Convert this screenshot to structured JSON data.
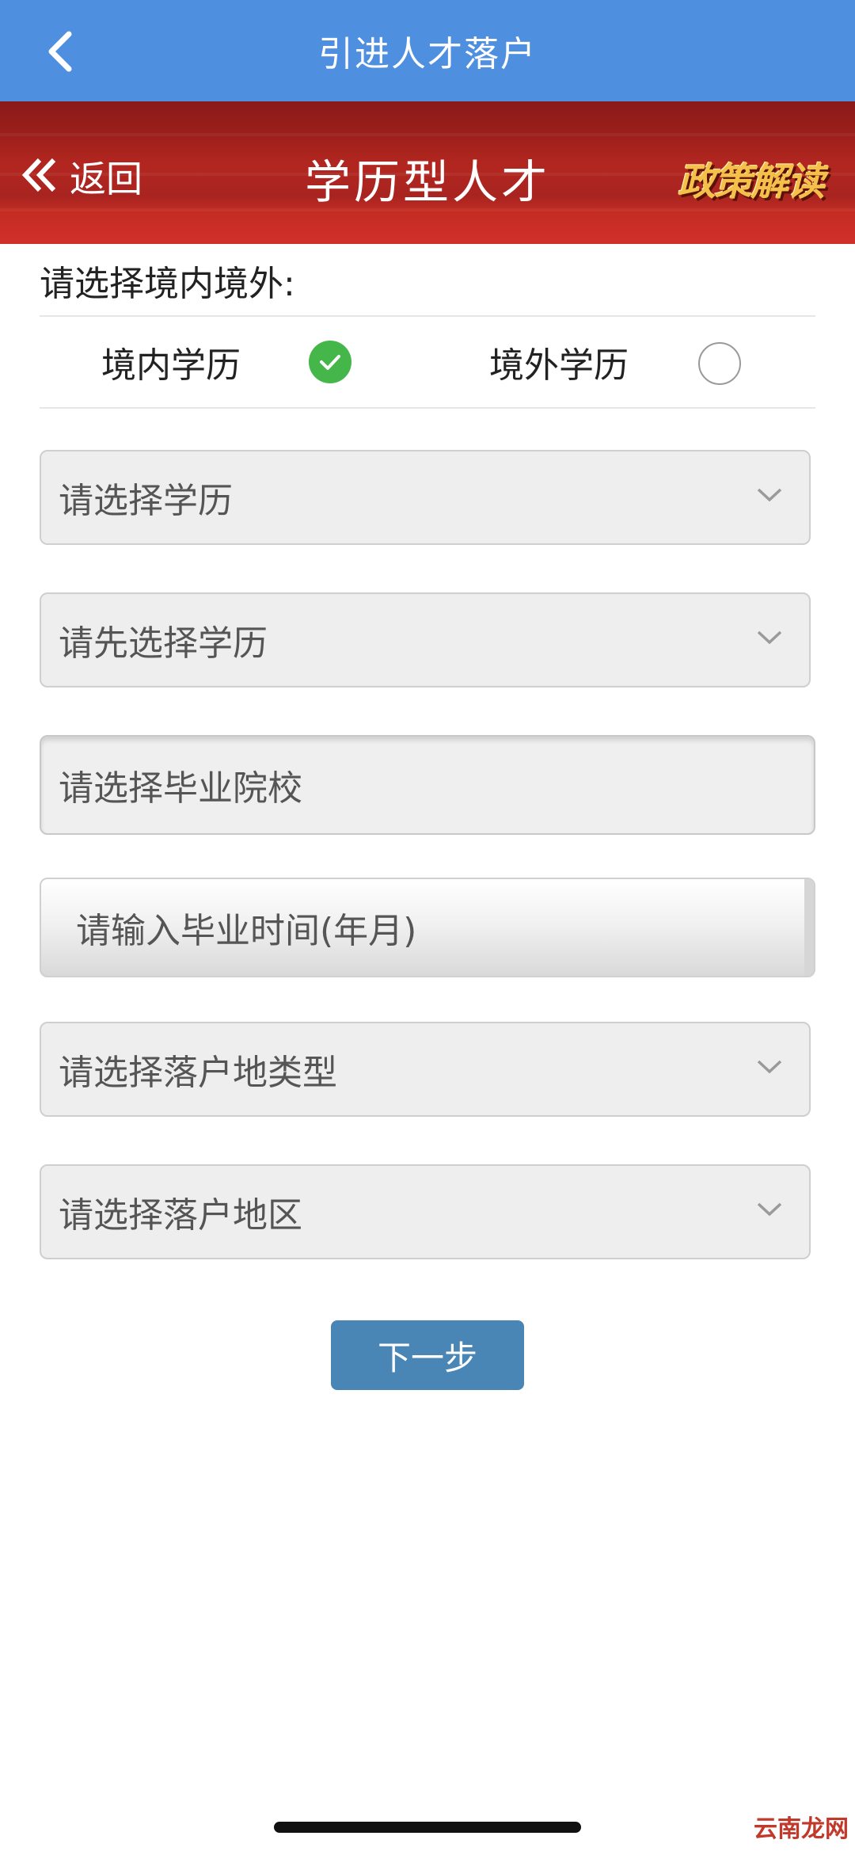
{
  "header": {
    "title": "引进人才落户"
  },
  "banner": {
    "back_label": "返回",
    "title": "学历型人才",
    "policy_label": "政策解读"
  },
  "section": {
    "label": "请选择境内境外:"
  },
  "options": [
    {
      "label": "境内学历",
      "selected": true
    },
    {
      "label": "境外学历",
      "selected": false
    }
  ],
  "fields": {
    "degree": "请选择学历",
    "degree_sub": "请先选择学历",
    "school": "请选择毕业院校",
    "grad_time": "请输入毕业时间(年月)",
    "settle_type": "请选择落户地类型",
    "settle_region": "请选择落户地区"
  },
  "next_button": {
    "label": "下一步"
  },
  "watermark": {
    "text": "云南龙网"
  },
  "colors": {
    "header_bg": "#4f8fe0",
    "banner_red": "#b32620",
    "check_green": "#45b74a",
    "button_blue": "#4a86b5"
  }
}
